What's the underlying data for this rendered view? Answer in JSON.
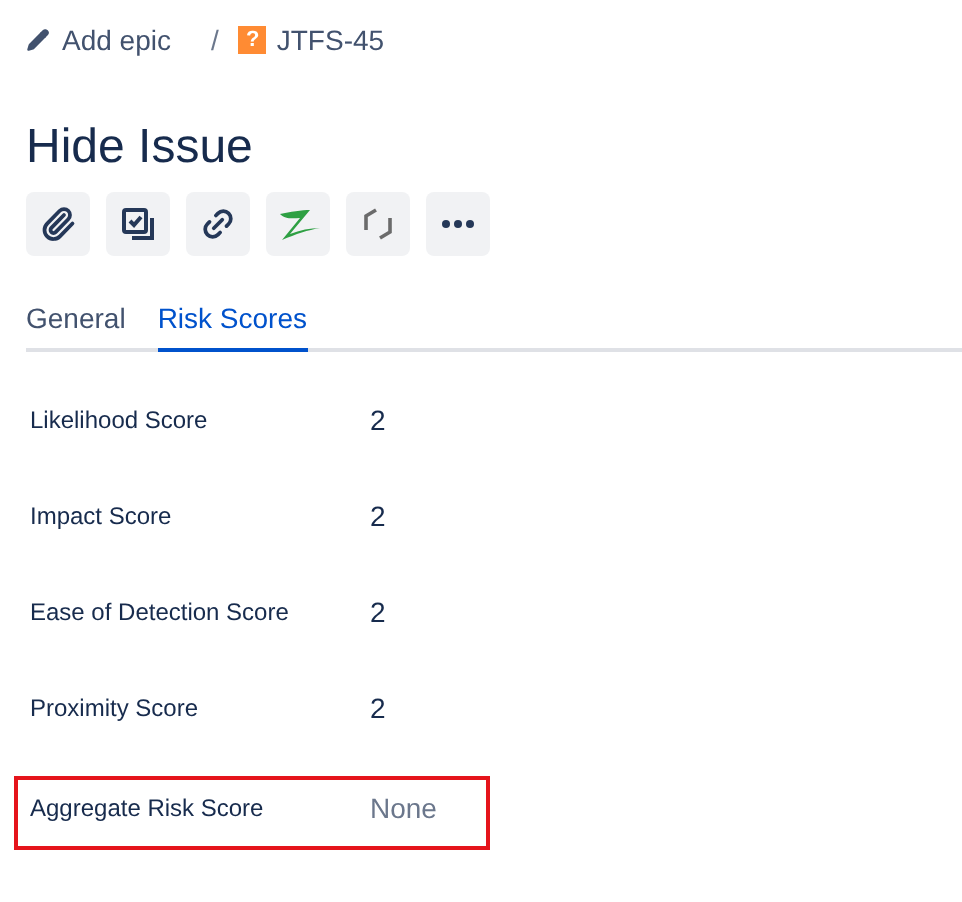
{
  "breadcrumb": {
    "epic_link": "Add epic",
    "separator": "/",
    "issue_key": "JTFS-45",
    "issue_type_glyph": "?"
  },
  "title": "Hide Issue",
  "tabs": [
    {
      "label": "General",
      "selected": false
    },
    {
      "label": "Risk Scores",
      "selected": true
    }
  ],
  "fields": [
    {
      "label": "Likelihood Score",
      "value": "2",
      "empty": false,
      "highlighted": false
    },
    {
      "label": "Impact Score",
      "value": "2",
      "empty": false,
      "highlighted": false
    },
    {
      "label": "Ease of Detection Score",
      "value": "2",
      "empty": false,
      "highlighted": false
    },
    {
      "label": "Proximity Score",
      "value": "2",
      "empty": false,
      "highlighted": false
    },
    {
      "label": "Aggregate Risk Score",
      "value": "None",
      "empty": true,
      "highlighted": true
    }
  ]
}
